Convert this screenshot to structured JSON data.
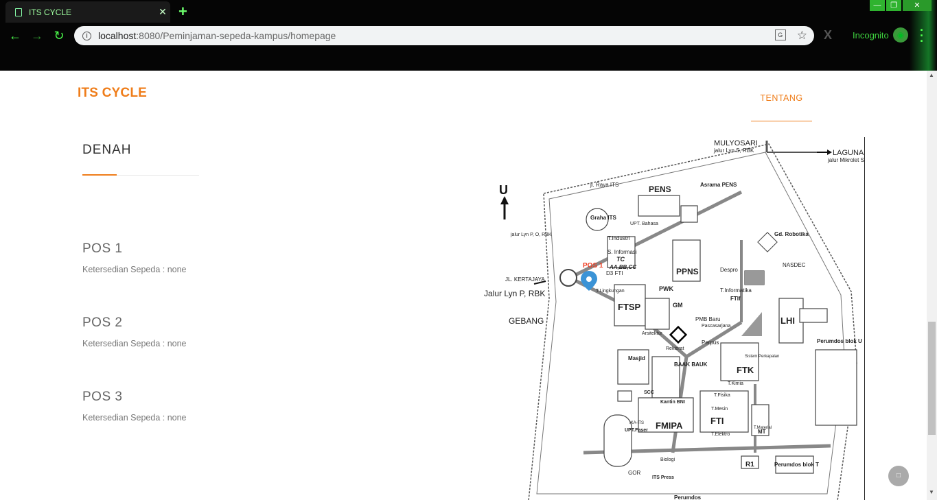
{
  "browser": {
    "tab_title": "ITS CYCLE",
    "tab_close": "✕",
    "new_tab": "+",
    "url_host": "localhost",
    "url_rest": ":8080/Peminjaman-sepeda-kampus/homepage",
    "incognito_label": "Incognito",
    "extension_label": "X",
    "window_buttons": [
      "—",
      "❐",
      "✕"
    ]
  },
  "site": {
    "brand": "ITS CYCLE",
    "nav_link": "TENTANG"
  },
  "main": {
    "section_title": "DENAH",
    "pos": [
      {
        "name": "POS 1",
        "info": "Ketersedian Sepeda : none"
      },
      {
        "name": "POS 2",
        "info": "Ketersedian Sepeda : none"
      },
      {
        "name": "POS 3",
        "info": "Ketersedian Sepeda : none"
      }
    ]
  },
  "map": {
    "labels": {
      "mulyosari": "MULYOSARI",
      "jalur_lyn_s": "jalur Lyn S, RBK",
      "laguna": "LAGUNA",
      "jalur_mikrolet": "jalur Mikrolet S",
      "u_arrow": "U",
      "raya_its": "jl. Raya ITS",
      "pens": "PENS",
      "asrama_pens": "Asrama PENS",
      "graha_its": "Graha ITS",
      "upt_bahasa": "UPT. Bahasa",
      "gd_robotika": "Gd. Robotika",
      "jalur_lyn_po": "jalur Lyn P, O, RBK",
      "t_industri": "T.Industri",
      "s_informasi": "S. Informasi",
      "tc": "TC",
      "pos1": "POS 1",
      "aabbcc": "AA,BB,CC",
      "d3fti": "D3 FTI",
      "ppns": "PPNS",
      "despro": "Despro",
      "nasdec": "NASDEC",
      "jl_kertajaya": "JL. KERTAJAYA",
      "jalur_lyn_p": "Jalur Lyn P, RBK",
      "t_lingkungan": "T.Lingkungan",
      "pwk": "PWK",
      "t_informatika": "T.Informatika",
      "ftif": "FTIf",
      "ftsp": "FTSP",
      "gm": "GM",
      "gebang": "GEBANG",
      "lhi": "LHI",
      "pmb_baru": "PMB Baru",
      "pascasarjana": "Pascasarjana",
      "arsitektur": "Arsitektur",
      "perpus": "Perpus",
      "rektorat": "Rektorat",
      "perumdos_u": "Perumdos blok U",
      "masjid": "Masjid",
      "baak": "BAAK BAUK",
      "ftk": "FTK",
      "sistem_perkapalan": "Sistem Perkapalan",
      "t_kimia": "T.Kimia",
      "scc": "SCC",
      "fmipa": "FMIPA",
      "fti": "FTI",
      "kantin_bni": "Kantin BNI",
      "t_fisika": "T.Fisika",
      "t_mesin": "T.Mesin",
      "t_elektro": "T.Elektro",
      "t_material": "T.Material",
      "mt": "MT",
      "upt_faser": "UPT.Faser",
      "ika_its": "IKA-ITS",
      "biologi": "Biologi",
      "gor": "GOR",
      "r1": "R1",
      "perumdos_t": "Perumdos blok T",
      "its_press": "ITS Press",
      "perumdos": "Perumdos"
    },
    "accent_color": "#ef3b1f",
    "marker_color": "#3b93d6"
  },
  "colors": {
    "brand": "#ef7d1a",
    "chrome_green": "#4cff4c"
  },
  "icons": {
    "back": "←",
    "forward": "→",
    "reload": "↻",
    "star": "☆",
    "to_top": "□"
  }
}
